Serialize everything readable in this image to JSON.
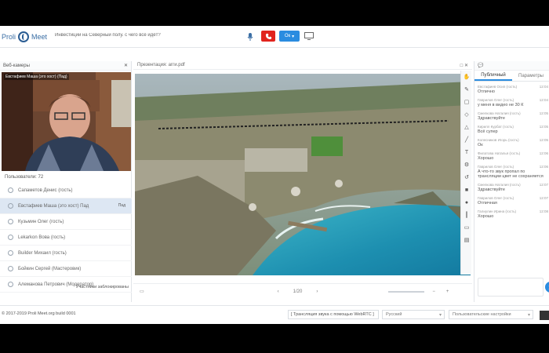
{
  "header": {
    "logo_left": "Proli",
    "logo_right": "Meet",
    "meeting_title": "Инвестиции на Северный полу. с чего всё идёт?",
    "split_button": "Ок"
  },
  "left_panel": {
    "title": "Веб-камеры",
    "video_label": "Евстафиев Маша (это хост) (Пад)",
    "participants_title": "Пользователи: 72",
    "participants": [
      {
        "name": "Сапаметов Денис (гость)",
        "active": false
      },
      {
        "name": "Евстафиев Маша (это хост) Пад",
        "active": true,
        "tag": "Пад"
      },
      {
        "name": "Кузьмин Олег (гость)",
        "active": false
      },
      {
        "name": "Lekarkon Вова (гость)",
        "active": false
      },
      {
        "name": "Builder Михаил (гость)",
        "active": false
      },
      {
        "name": "Бойкин Сергей (Мастеровик)",
        "active": false
      },
      {
        "name": "Алеманова Петрович (Модератор)",
        "active": false
      },
      {
        "name": "Тушаков Семён (гость)",
        "active": false
      }
    ],
    "management_label": "Участники заблокированы"
  },
  "center": {
    "title": "Презентация: агги.pdf",
    "page": "1/20"
  },
  "right_panel": {
    "tab_public": "Публичный",
    "tab_params": "Параметры",
    "messages": [
      {
        "author": "Евстафиев Осип (гость)",
        "time": "12:04",
        "text": "Отлично"
      },
      {
        "author": "Гаврилов Олег (гость)",
        "time": "12:04",
        "text": "у меня в видео не 30 К"
      },
      {
        "author": "Смелкова Наталия (гость)",
        "time": "12:05",
        "text": "Здравствуйте"
      },
      {
        "author": "Кирилл Курбат (гость)",
        "time": "12:05",
        "text": "Всё супер"
      },
      {
        "author": "Колесников Игорь (гость)",
        "time": "12:05",
        "text": "Ок"
      },
      {
        "author": "Филатова Наталья (гость)",
        "time": "12:06",
        "text": "Хорошо"
      },
      {
        "author": "Гаврилов Олег (гость)",
        "time": "12:06",
        "text": "А что-то звук пропал по трансляции цвет не сохраняется"
      },
      {
        "author": "Смелкова Наталия (гость)",
        "time": "12:07",
        "text": "Здравствуйте"
      },
      {
        "author": "Гаврилов Олег (гость)",
        "time": "12:07",
        "text": "Отличная"
      },
      {
        "author": "Галиулин Ирина (гость)",
        "time": "12:08",
        "text": "Хорошо"
      }
    ]
  },
  "footer": {
    "copyright": "© 2017-2019 Proli Meet.org build 0001",
    "subtitles": "[ Трансляция звука с помощью WebRTC ]",
    "language": "Русский",
    "quality": "Пользовательские настройки"
  }
}
